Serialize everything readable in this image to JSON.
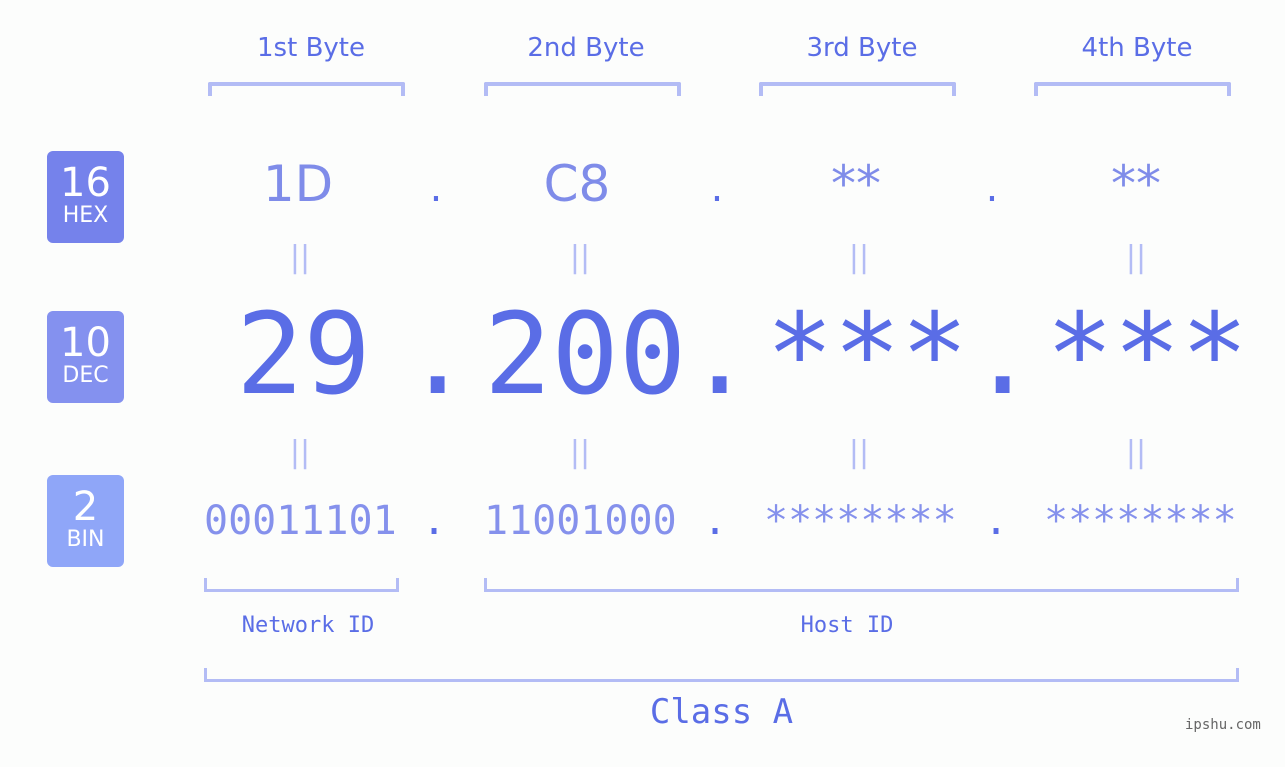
{
  "bytes": {
    "headers": [
      "1st Byte",
      "2nd Byte",
      "3rd Byte",
      "4th Byte"
    ]
  },
  "rows": {
    "hex": {
      "badge_num": "16",
      "badge_label": "HEX",
      "badge_color": "#7582eb",
      "values": [
        "1D",
        "C8",
        "**",
        "**"
      ]
    },
    "dec": {
      "badge_num": "10",
      "badge_label": "DEC",
      "badge_color": "#8491ef",
      "values": [
        "29",
        "200",
        "***",
        "***"
      ]
    },
    "bin": {
      "badge_num": "2",
      "badge_label": "BIN",
      "badge_color": "#8fa6f8",
      "values": [
        "00011101",
        "11001000",
        "********",
        "********"
      ]
    }
  },
  "separator": ".",
  "equals": "||",
  "segments": {
    "network": "Network ID",
    "host": "Host ID",
    "class": "Class A"
  },
  "watermark": "ipshu.com",
  "colors": {
    "accent": "#5a6de6",
    "light": "#b3bcf5",
    "hex_text": "#7f8ce9"
  }
}
